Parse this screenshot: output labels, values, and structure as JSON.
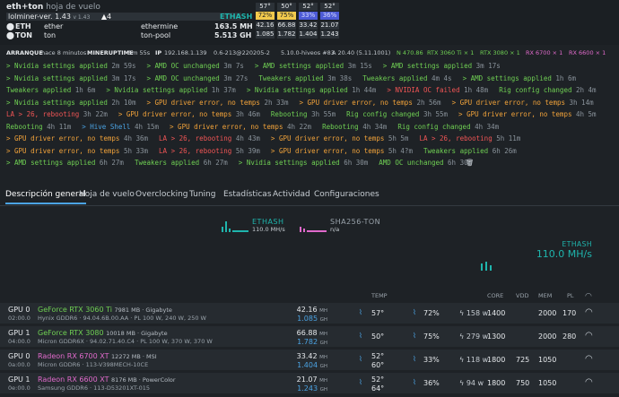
{
  "rig": {
    "name": "eth+ton",
    "subtitle": "hoja de vuelo",
    "miner_version": "lolminer-ver. 1.43",
    "miner_version_small": "v 1.43",
    "alerts": "▲4",
    "algo": "ETHASH"
  },
  "coins": [
    {
      "coin": "ETH",
      "name": "ether",
      "pool": "ethermine",
      "hashrate": "163.5 MH"
    },
    {
      "coin": "TON",
      "name": "ton",
      "pool": "ton-pool",
      "hashrate": "5.513 GH"
    }
  ],
  "temps_header": [
    "57°",
    "50°",
    "52°",
    "52°"
  ],
  "fans": [
    "72%",
    "75%",
    "33%",
    "36%"
  ],
  "per_gpu_eth": [
    "42.16",
    "66.88",
    "33.42",
    "21.07"
  ],
  "per_gpu_ton": [
    "1.085",
    "1.782",
    "1.404",
    "1.243"
  ],
  "status": {
    "arranque_label": "ARRANQUE",
    "arranque_value": "hace 8 minutos",
    "mineruptime_label": "MINERUPTIME",
    "mineruptime_value": "5m 55s",
    "ip_label": "IP",
    "ip_value": "192.168.1.139",
    "hive_ver": "0.6-213@220205-2",
    "kernel": "5.10.0-hiveos #83",
    "driver": "A 20.40 (5.11.1001)",
    "nvidia_driver": "N 470.86",
    "gpu1": "RTX 3060 Ti × 1",
    "gpu2": "RTX 3080 × 1",
    "gpu3": "RX 6700 × 1",
    "gpu4": "RX 6600 × 1"
  },
  "events": [
    [
      {
        "text": "> Nvidia settings applied",
        "time": "2m 59s",
        "color": "green"
      },
      {
        "text": "> AMD OC unchanged",
        "time": "3m 7s",
        "color": "green"
      },
      {
        "text": "> AMD settings applied",
        "time": "3m 15s",
        "color": "green"
      },
      {
        "text": "> AMD settings applied",
        "time": "3m 17s",
        "color": "green"
      }
    ],
    [
      {
        "text": "> Nvidia settings applied",
        "time": "3m 17s",
        "color": "green"
      },
      {
        "text": "> AMD OC unchanged",
        "time": "3m 27s",
        "color": "green"
      },
      {
        "text": "Tweakers applied",
        "time": "3m 38s",
        "color": "green"
      },
      {
        "text": "Tweakers applied",
        "time": "4m 4s",
        "color": "green"
      },
      {
        "text": "> AMD settings applied",
        "time": "1h 6m",
        "color": "green"
      }
    ],
    [
      {
        "text": "Tweakers applied",
        "time": "1h 6m",
        "color": "green"
      },
      {
        "text": "> Nvidia settings applied",
        "time": "1h 37m",
        "color": "green"
      },
      {
        "text": "> Nvidia settings applied",
        "time": "1h 44m",
        "color": "green"
      },
      {
        "text": "> NVIDIA OC failed",
        "time": "1h 48m",
        "color": "red"
      },
      {
        "text": "Rig config changed",
        "time": "2h 4m",
        "color": "green"
      }
    ],
    [
      {
        "text": "> Nvidia settings applied",
        "time": "2h 10m",
        "color": "green"
      },
      {
        "text": "> GPU driver error, no temps",
        "time": "2h 33m",
        "color": "orange"
      },
      {
        "text": "> GPU driver error, no temps",
        "time": "2h 56m",
        "color": "orange"
      },
      {
        "text": "> GPU driver error, no temps",
        "time": "3h 14m",
        "color": "orange"
      }
    ],
    [
      {
        "text": "LA > 26, rebooting",
        "time": "3h 22m",
        "color": "red"
      },
      {
        "text": "> GPU driver error, no temps",
        "time": "3h 46m",
        "color": "orange"
      },
      {
        "text": "Rebooting",
        "time": "3h 55m",
        "color": "green"
      },
      {
        "text": "Rig config changed",
        "time": "3h 55m",
        "color": "green"
      },
      {
        "text": "> GPU driver error, no temps",
        "time": "4h 5m",
        "color": "orange"
      }
    ],
    [
      {
        "text": "Rebooting",
        "time": "4h 11m",
        "color": "green"
      },
      {
        "text": "> Hive Shell",
        "time": "4h 15m",
        "color": "blue"
      },
      {
        "text": "> GPU driver error, no temps",
        "time": "4h 22m",
        "color": "orange"
      },
      {
        "text": "Rebooting",
        "time": "4h 34m",
        "color": "green"
      },
      {
        "text": "Rig config changed",
        "time": "4h 34m",
        "color": "green"
      }
    ],
    [
      {
        "text": "> GPU driver error, no temps",
        "time": "4h 36m",
        "color": "orange"
      },
      {
        "text": "LA > 26, rebooting",
        "time": "4h 43m",
        "color": "red"
      },
      {
        "text": "> GPU driver error, no temps",
        "time": "5h 5m",
        "color": "orange"
      },
      {
        "text": "LA > 26, rebooting",
        "time": "5h 11m",
        "color": "red"
      }
    ],
    [
      {
        "text": "> GPU driver error, no temps",
        "time": "5h 33m",
        "color": "orange"
      },
      {
        "text": "LA > 26, rebooting",
        "time": "5h 39m",
        "color": "red"
      },
      {
        "text": "> GPU driver error, no temps",
        "time": "5h 4?m",
        "color": "orange"
      },
      {
        "text": "Tweakers applied",
        "time": "6h 26m",
        "color": "green"
      }
    ],
    [
      {
        "text": "> AMD settings applied",
        "time": "6h 27m",
        "color": "green"
      },
      {
        "text": "Tweakers applied",
        "time": "6h 27m",
        "color": "green"
      },
      {
        "text": "> Nvidia settings applied",
        "time": "6h 30m",
        "color": "green"
      },
      {
        "text": "AMD OC unchanged",
        "time": "6h 30m",
        "color": "green"
      }
    ]
  ],
  "tabs": [
    "Descripción general",
    "Hoja de vuelo",
    "Overclocking",
    "Tuning",
    "Estadísticas",
    "Actividad",
    "Configuraciones"
  ],
  "algos": [
    {
      "name": "ETHASH",
      "rate": "110.0 MH/s"
    },
    {
      "name": "SHA256-TON",
      "rate": "n/a"
    }
  ],
  "total": {
    "algo": "ETHASH",
    "rate": "110.0 MH/s"
  },
  "gpu_header": {
    "temp": "TEMP",
    "core": "CORE",
    "vdd": "VDD",
    "mem": "MEM",
    "pl": "PL"
  },
  "gpus": [
    {
      "idx": "GPU 0",
      "bus": "02:00.0",
      "model": "GeForce RTX 3060 Ti",
      "mem": "7981 MB · Gigabyte",
      "detail": "Hynix GDDR6 · 94.04.6B.00.AA · PL 100 W, 240 W, 250 W",
      "h1": "42.16",
      "u1": "MH",
      "h2": "1.085",
      "u2": "GH",
      "t1": "57°",
      "t2": "",
      "fan": "72%",
      "pow": "158 w",
      "core": "1400",
      "vdd": "",
      "memclk": "2000",
      "pl": "170",
      "amd": false
    },
    {
      "idx": "GPU 1",
      "bus": "04:00.0",
      "model": "GeForce RTX 3080",
      "mem": "10018 MB · Gigabyte",
      "detail": "Micron GDDR6X · 94.02.71.40.C4 · PL 100 W, 370 W, 370 W",
      "h1": "66.88",
      "u1": "MH",
      "h2": "1.782",
      "u2": "GH",
      "t1": "50°",
      "t2": "",
      "fan": "75%",
      "pow": "279 w",
      "core": "1300",
      "vdd": "",
      "memclk": "2000",
      "pl": "280",
      "amd": false
    },
    {
      "idx": "GPU 0",
      "bus": "0a:00.0",
      "model": "Radeon RX 6700 XT",
      "mem": "12272 MB · MSI",
      "detail": "Micron GDDR6 · 113-V398MECH-10CE",
      "h1": "33.42",
      "u1": "MH",
      "h2": "1.404",
      "u2": "GH",
      "t1": "52°",
      "t2": "60°",
      "fan": "33%",
      "pow": "118 w",
      "core": "1800",
      "vdd": "725",
      "memclk": "1050",
      "pl": "",
      "amd": true
    },
    {
      "idx": "GPU 1",
      "bus": "0e:00.0",
      "model": "Radeon RX 6600 XT",
      "mem": "8176 MB · PowerColor",
      "detail": "Samsung GDDR6 · 113-D53201XT-015",
      "h1": "21.07",
      "u1": "MH",
      "h2": "1.243",
      "u2": "GH",
      "t1": "52°",
      "t2": "64°",
      "fan": "36%",
      "pow": "94 w",
      "core": "1800",
      "vdd": "750",
      "memclk": "1050",
      "pl": "",
      "amd": true
    }
  ]
}
